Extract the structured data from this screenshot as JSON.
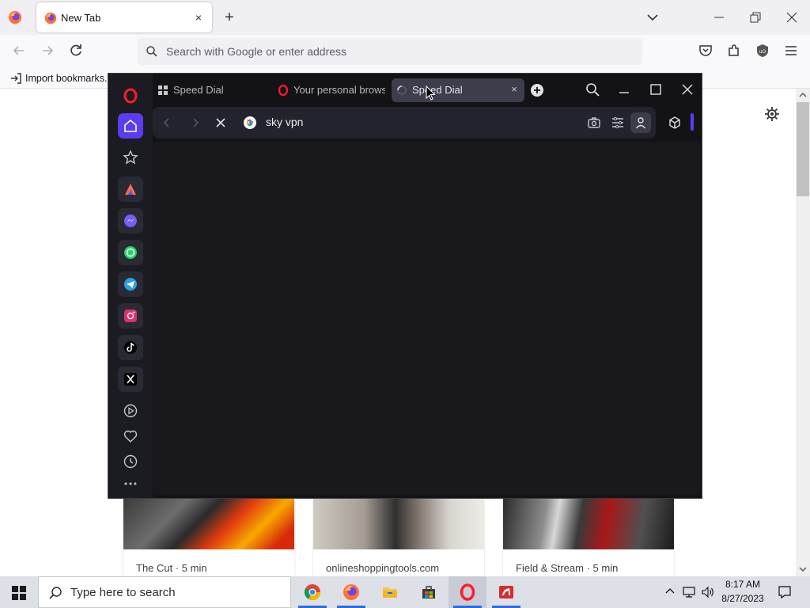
{
  "firefox": {
    "tab_title": "New Tab",
    "tab_close": "×",
    "new_tab": "+",
    "url_placeholder": "Search with Google or enter address",
    "bookmarks_import": "Import bookmarks..."
  },
  "stories": [
    {
      "meta": "The Cut · 5 min"
    },
    {
      "meta": "onlineshoppingtools.com"
    },
    {
      "meta": "Field & Stream · 5 min"
    }
  ],
  "opera": {
    "tabs": [
      {
        "label": "Speed Dial"
      },
      {
        "label": "Your personal browser"
      },
      {
        "label": "Speed Dial",
        "close": "×"
      }
    ],
    "url": "sky vpn"
  },
  "taskbar": {
    "search_placeholder": "Type here to search",
    "time": "8:17 AM",
    "date": "8/27/2023"
  },
  "colors": {
    "opera_accent": "#5b3cf0",
    "opera_bg": "#131316",
    "firefox_chrome": "#f0f0f4"
  }
}
